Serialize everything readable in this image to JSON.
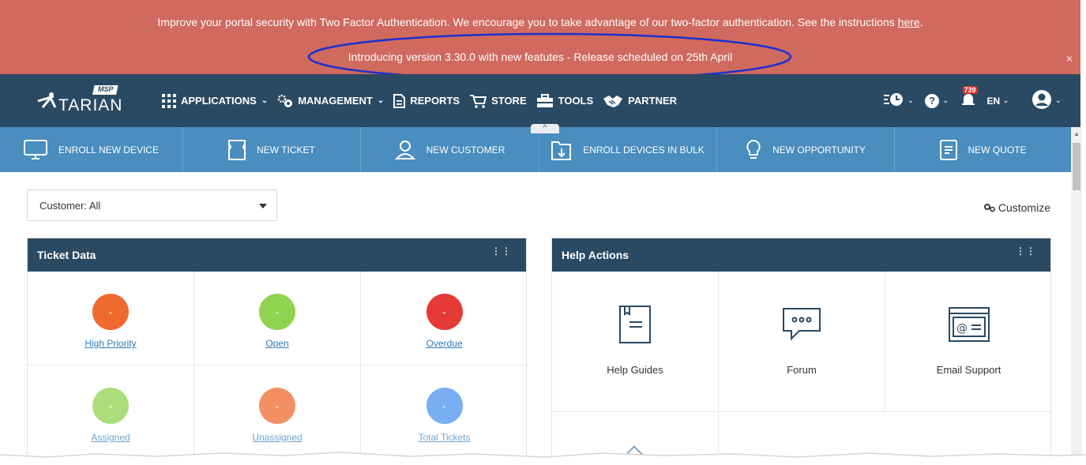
{
  "banner": {
    "line1_text": "Improve your portal security with Two Factor Authentication. We encourage you to take advantage of our two-factor authentication. See the instructions ",
    "line1_link": "here",
    "line1_end": ".",
    "line2_text": "Introducing version 3.30.0 with new featutes - Release scheduled on 25th April",
    "close_label": "×",
    "annotation_color": "#1a2fd0"
  },
  "nav": {
    "logo_text": "TARIAN",
    "logo_badge": "MSP",
    "items": [
      {
        "label": "APPLICATIONS",
        "icon": "grid-icon",
        "chevron": true
      },
      {
        "label": "MANAGEMENT",
        "icon": "gears-icon",
        "chevron": true
      },
      {
        "label": "REPORTS",
        "icon": "document-icon",
        "chevron": false
      },
      {
        "label": "STORE",
        "icon": "cart-icon",
        "chevron": false
      },
      {
        "label": "TOOLS",
        "icon": "toolbox-icon",
        "chevron": false
      },
      {
        "label": "PARTNER",
        "icon": "handshake-icon",
        "chevron": false
      }
    ],
    "notifications_count": "739",
    "language": "EN",
    "colors": {
      "nav_bg": "#2a4a63",
      "banner_bg": "#d0695e",
      "quickbar_bg": "#4a8dbf"
    }
  },
  "quick_actions": [
    {
      "label": "ENROLL NEW DEVICE",
      "icon": "monitor-icon"
    },
    {
      "label": "NEW TICKET",
      "icon": "ticket-icon"
    },
    {
      "label": "NEW CUSTOMER",
      "icon": "user-icon"
    },
    {
      "label": "ENROLL DEVICES IN BULK",
      "icon": "bulk-enroll-icon"
    },
    {
      "label": "NEW OPPORTUNITY",
      "icon": "lightbulb-icon"
    },
    {
      "label": "NEW QUOTE",
      "icon": "quote-document-icon"
    }
  ],
  "filter": {
    "label": "Customer: All"
  },
  "customize_label": "Customize",
  "ticket_panel": {
    "title": "Ticket Data",
    "cells": [
      {
        "label": "High Priority",
        "value": "-",
        "color": "#f06a2f"
      },
      {
        "label": "Open",
        "value": "-",
        "color": "#8fd34f"
      },
      {
        "label": "Overdue",
        "value": "-",
        "color": "#e53a35"
      },
      {
        "label": "Assigned",
        "value": "-",
        "color": "#8fd34f"
      },
      {
        "label": "Unassigned",
        "value": "-",
        "color": "#f06a2f"
      },
      {
        "label": "Total Tickets",
        "value": "-",
        "color": "#4b93ee"
      }
    ]
  },
  "help_panel": {
    "title": "Help Actions",
    "cells": [
      {
        "label": "Help Guides",
        "icon": "book-icon"
      },
      {
        "label": "Forum",
        "icon": "chat-bubbles-icon"
      },
      {
        "label": "Email Support",
        "icon": "email-window-icon"
      }
    ]
  }
}
